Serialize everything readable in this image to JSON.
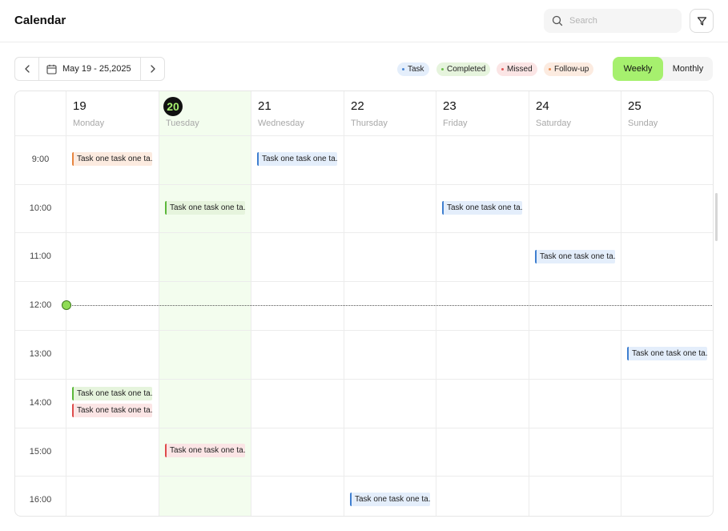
{
  "app": {
    "title": "Calendar"
  },
  "search": {
    "placeholder": "Search",
    "value": ""
  },
  "date_range": {
    "label": "May 19 - 25,2025"
  },
  "legend": {
    "task": "Task",
    "completed": "Completed",
    "missed": "Missed",
    "followup": "Follow-up"
  },
  "view": {
    "weekly": "Weekly",
    "monthly": "Monthly",
    "selected": "Weekly"
  },
  "days": [
    {
      "num": "19",
      "name": "Monday"
    },
    {
      "num": "20",
      "name": "Tuesday"
    },
    {
      "num": "21",
      "name": "Wednesday"
    },
    {
      "num": "22",
      "name": "Thursday"
    },
    {
      "num": "23",
      "name": "Friday"
    },
    {
      "num": "24",
      "name": "Saturday"
    },
    {
      "num": "25",
      "name": "Sunday"
    }
  ],
  "times": [
    "9:00",
    "10:00",
    "11:00",
    "12:00",
    "13:00",
    "14:00",
    "15:00",
    "16:00"
  ],
  "events": [
    {
      "day": "19",
      "time": "9:00",
      "type": "follow-up",
      "title": "Task one task one ta..."
    },
    {
      "day": "21",
      "time": "9:00",
      "type": "task",
      "title": "Task one task one ta..."
    },
    {
      "day": "20",
      "time": "10:00",
      "type": "completed",
      "title": "Task one task one ta..."
    },
    {
      "day": "23",
      "time": "10:00",
      "type": "task",
      "title": "Task one task one ta..."
    },
    {
      "day": "24",
      "time": "11:00",
      "type": "task",
      "title": "Task one task one ta..."
    },
    {
      "day": "25",
      "time": "13:00",
      "type": "task",
      "title": "Task one task one ta..."
    },
    {
      "day": "19",
      "time": "14:00",
      "type": "completed",
      "title": "Task one task one ta..."
    },
    {
      "day": "19",
      "time": "14:00",
      "type": "missed",
      "title": "Task one task one ta..."
    },
    {
      "day": "20",
      "time": "15:00",
      "type": "missed",
      "title": "Task one task one ta..."
    },
    {
      "day": "22",
      "time": "16:00",
      "type": "task",
      "title": "Task one task one ta..."
    }
  ],
  "colors": {
    "accent": "#a6f06e",
    "task": "#3f7fd0",
    "completed": "#5bb83a",
    "missed": "#de4b4b",
    "followup": "#e7853f",
    "today_column": "#f3fdee"
  },
  "icons": {
    "search": "search-icon",
    "filter": "filter-icon",
    "prev": "chevron-left-icon",
    "next": "chevron-right-icon",
    "calendar": "calendar-icon"
  }
}
